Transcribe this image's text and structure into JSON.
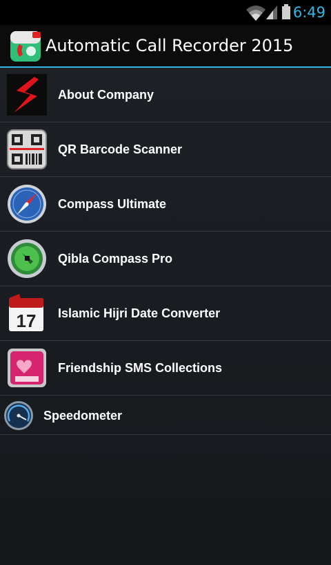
{
  "status_bar": {
    "time": "6:49",
    "icons": [
      "wifi-icon",
      "cell-signal-icon",
      "battery-icon"
    ],
    "accent_color": "#33b5e5"
  },
  "action_bar": {
    "title": "Automatic Call Recorder 2015",
    "app_icon": "call-recorder-icon"
  },
  "list": {
    "items": [
      {
        "label": "About Company",
        "icon": "company-logo-icon"
      },
      {
        "label": "QR Barcode Scanner",
        "icon": "qr-barcode-icon"
      },
      {
        "label": "Compass Ultimate",
        "icon": "compass-icon"
      },
      {
        "label": "Qibla Compass Pro",
        "icon": "qibla-compass-icon"
      },
      {
        "label": "Islamic Hijri Date Converter",
        "icon": "calendar-icon",
        "icon_text": "17"
      },
      {
        "label": "Friendship SMS Collections",
        "icon": "sms-collection-icon"
      },
      {
        "label": "Speedometer",
        "icon": "speedometer-icon"
      }
    ]
  }
}
